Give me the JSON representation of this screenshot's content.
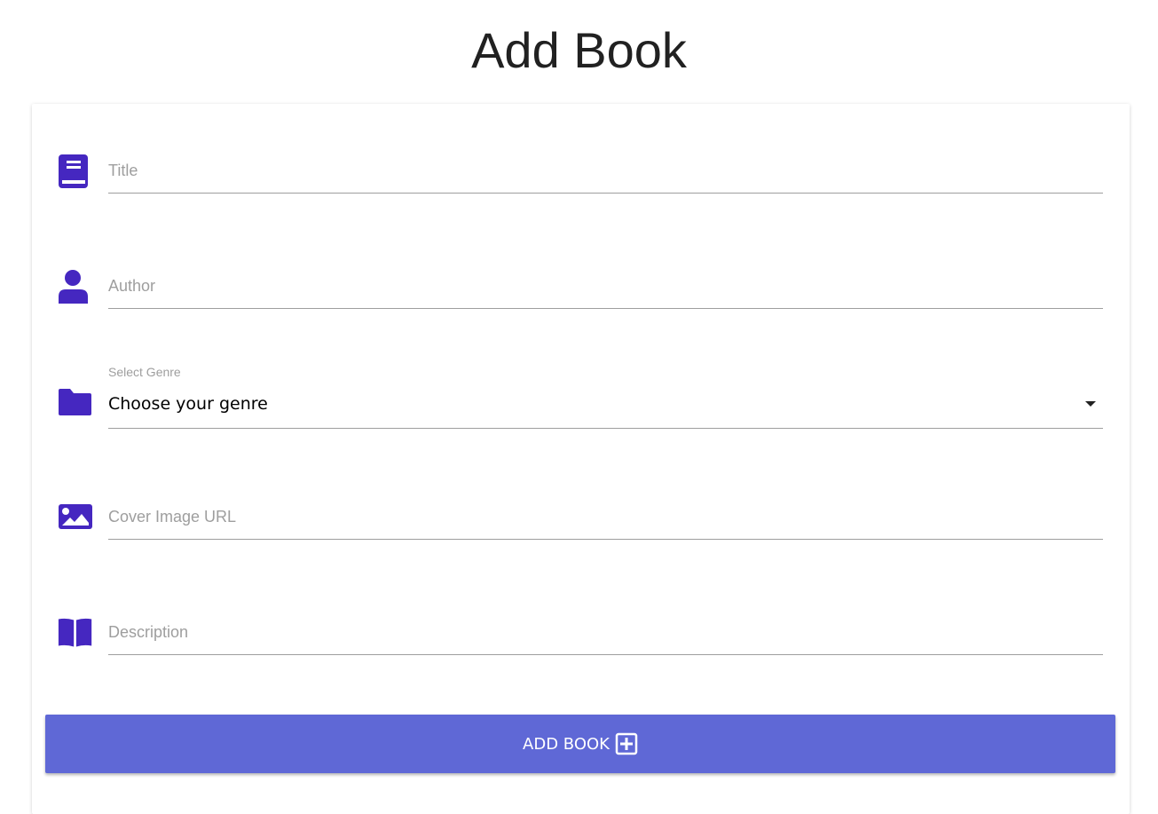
{
  "page": {
    "title": "Add Book"
  },
  "form": {
    "title": {
      "placeholder": "Title",
      "value": ""
    },
    "author": {
      "placeholder": "Author",
      "value": ""
    },
    "genre": {
      "label": "Select Genre",
      "value": "Choose your genre"
    },
    "cover": {
      "placeholder": "Cover Image URL",
      "value": ""
    },
    "description": {
      "placeholder": "Description",
      "value": ""
    },
    "submit_label": "ADD BOOK"
  },
  "colors": {
    "icon": "#4527c0",
    "button": "#5f68d6"
  }
}
